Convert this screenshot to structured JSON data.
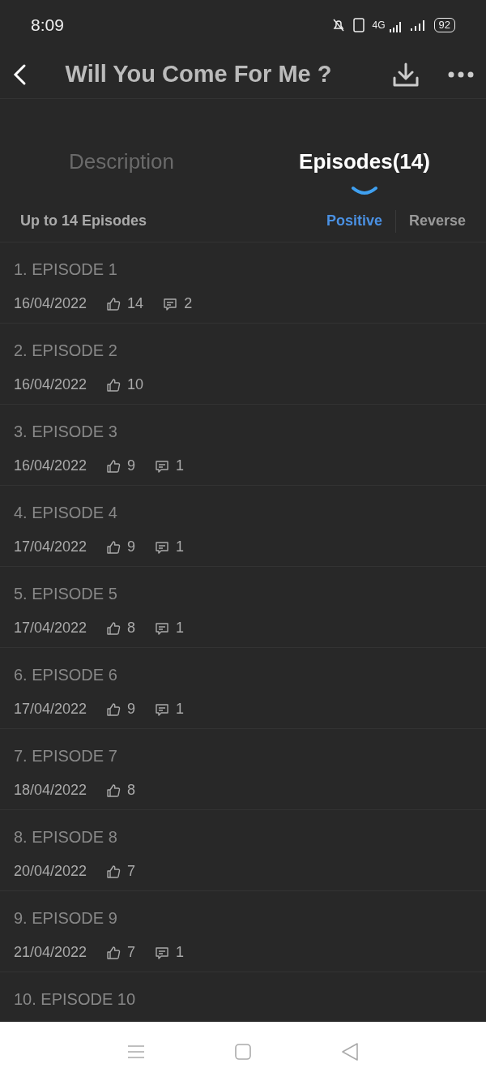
{
  "status_bar": {
    "time": "8:09",
    "network": "4G",
    "battery": "92"
  },
  "header": {
    "title": "Will You Come For Me ?"
  },
  "tabs": [
    {
      "label": "Description",
      "selected": false
    },
    {
      "label": "Episodes(14)",
      "selected": true
    }
  ],
  "list_header": {
    "summary": "Up to 14 Episodes",
    "sort": [
      {
        "label": "Positive",
        "selected": true
      },
      {
        "label": "Reverse",
        "selected": false
      }
    ]
  },
  "episodes": [
    {
      "title": "1. EPISODE 1",
      "date": "16/04/2022",
      "likes": "14",
      "comments": "2"
    },
    {
      "title": "2. EPISODE 2",
      "date": "16/04/2022",
      "likes": "10"
    },
    {
      "title": "3. EPISODE 3",
      "date": "16/04/2022",
      "likes": "9",
      "comments": "1"
    },
    {
      "title": "4. EPISODE 4",
      "date": "17/04/2022",
      "likes": "9",
      "comments": "1"
    },
    {
      "title": "5. EPISODE 5",
      "date": "17/04/2022",
      "likes": "8",
      "comments": "1"
    },
    {
      "title": "6. EPISODE 6",
      "date": "17/04/2022",
      "likes": "9",
      "comments": "1"
    },
    {
      "title": "7. EPISODE 7",
      "date": "18/04/2022",
      "likes": "8"
    },
    {
      "title": "8. EPISODE 8",
      "date": "20/04/2022",
      "likes": "7"
    },
    {
      "title": "9. EPISODE 9",
      "date": "21/04/2022",
      "likes": "7",
      "comments": "1"
    },
    {
      "title": "10. EPISODE 10"
    }
  ]
}
